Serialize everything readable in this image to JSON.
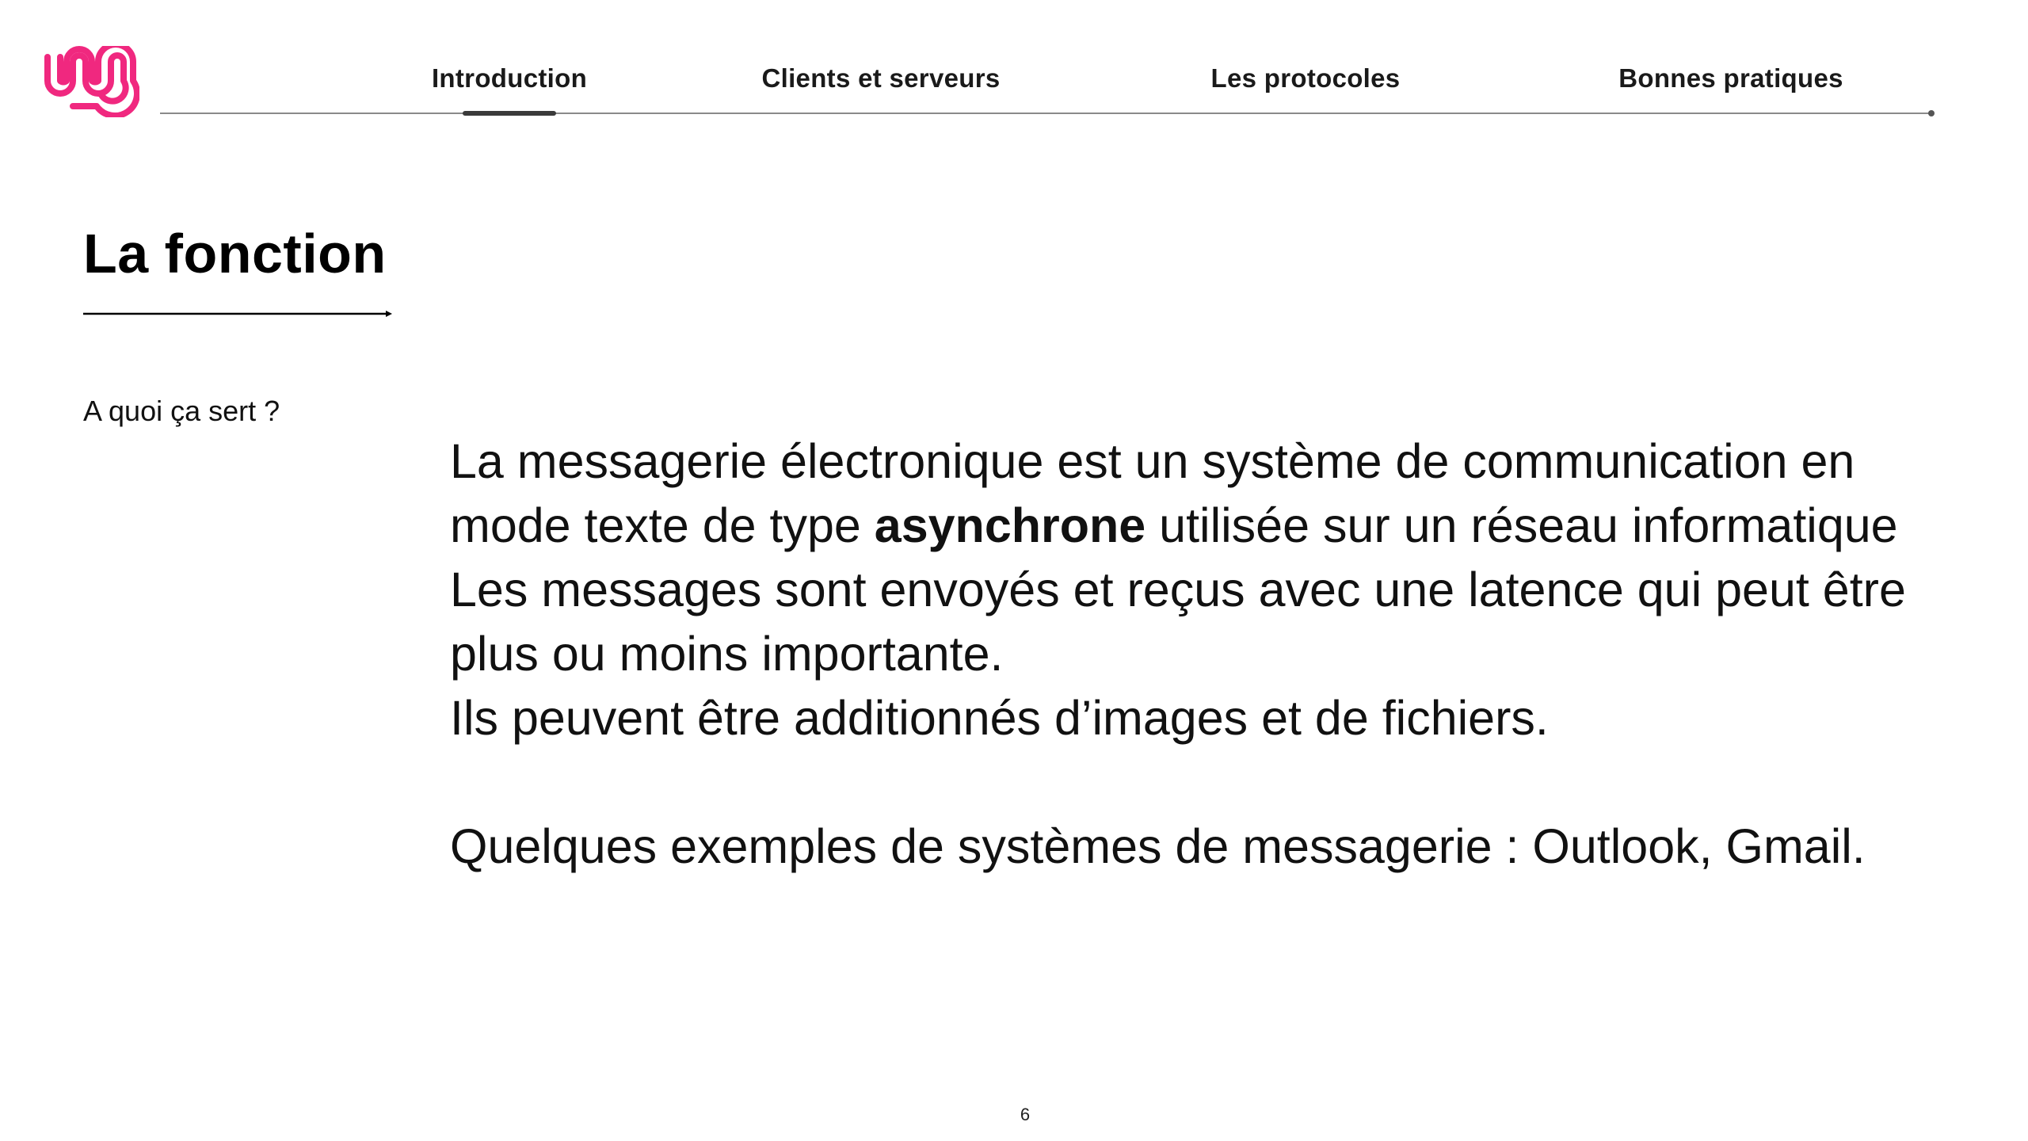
{
  "nav": {
    "items": [
      {
        "label": "Introduction",
        "active": true
      },
      {
        "label": "Clients et serveurs",
        "active": false
      },
      {
        "label": "Les protocoles",
        "active": false
      },
      {
        "label": "Bonnes pratiques",
        "active": false
      }
    ]
  },
  "logo": {
    "icon": "brand-logo-icon",
    "color": "#f0287f"
  },
  "slide": {
    "title": "La fonction",
    "subtitle": "A quoi ça sert ?",
    "paragraph1": {
      "before_bold": "La messagerie électronique est un système de communication en mode texte de type ",
      "bold": "asynchrone",
      "after_bold": " utilisée sur un réseau informatique"
    },
    "paragraph2": "Les messages sont envoyés et reçus avec une latence qui peut être plus ou moins importante.",
    "paragraph3": "Ils peuvent être additionnés d’images et de fichiers.",
    "paragraph4": "Quelques exemples de systèmes de messagerie : Outlook, Gmail.",
    "page_number": "6"
  },
  "colors": {
    "accent": "#f0287f",
    "text": "#111111",
    "rule": "#8a8a8a"
  }
}
